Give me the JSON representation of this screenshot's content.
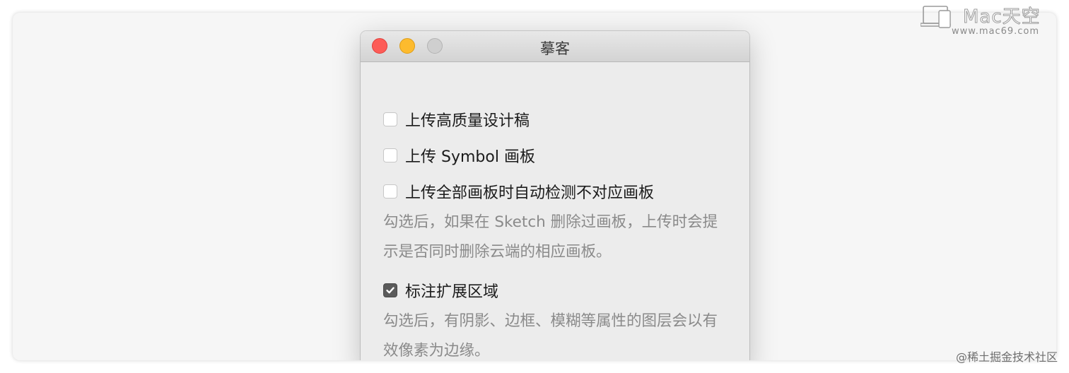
{
  "window": {
    "title": "摹客"
  },
  "options": [
    {
      "label": "上传高质量设计稿",
      "checked": false
    },
    {
      "label": "上传 Symbol 画板",
      "checked": false
    },
    {
      "label": "上传全部画板时自动检测不对应画板",
      "checked": false
    },
    {
      "label": "标注扩展区域",
      "checked": true
    }
  ],
  "descriptions": {
    "auto_detect": "勾选后，如果在 Sketch 删除过画板，上传时会提示是否同时删除云端的相应画板。",
    "annotation_extend": "勾选后，有阴影、边框、模糊等属性的图层会以有效像素为边缘。"
  },
  "watermark": {
    "title": "Mac天空",
    "url": "www.mac69.com"
  },
  "credit": "@稀土掘金技术社区",
  "colors": {
    "close": "#fd5c57",
    "minimize": "#fdbb2e",
    "zoom_disabled": "#cfcfcf",
    "checkbox_checked": "#5a5a5a",
    "description_text": "#8a8a8a"
  },
  "icons": [
    "close-icon",
    "minimize-icon",
    "zoom-icon",
    "checkmark-icon",
    "mac-logo-icon"
  ]
}
